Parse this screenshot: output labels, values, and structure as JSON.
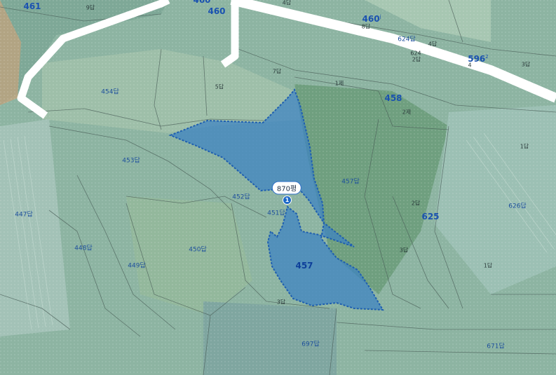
{
  "map": {
    "selection": {
      "area_label": "870평",
      "marker_number": "1",
      "parcel_number": "457"
    },
    "parcel_numbers": [
      {
        "id": "p461",
        "text": "461"
      },
      {
        "id": "p460",
        "text": "460"
      },
      {
        "id": "p460b",
        "text": "460"
      },
      {
        "id": "p458",
        "text": "458"
      },
      {
        "id": "p596",
        "text": "596"
      },
      {
        "id": "p625",
        "text": "625"
      }
    ],
    "parcel_numbers_suffix": {
      "p460b": "j",
      "p596": "2"
    },
    "lot_labels": [
      {
        "id": "l9dap",
        "text": "9답"
      },
      {
        "id": "l4dap_top",
        "text": "4답"
      },
      {
        "id": "l8dap",
        "text": "8답"
      },
      {
        "id": "l624dap",
        "text": "624답"
      },
      {
        "id": "l4dap_r",
        "text": "4답"
      },
      {
        "id": "l624",
        "text": "624"
      },
      {
        "id": "l2dap_top",
        "text": "2답"
      },
      {
        "id": "l4",
        "text": "4"
      },
      {
        "id": "l3dap_r",
        "text": "3답"
      },
      {
        "id": "l7dap",
        "text": "7답"
      },
      {
        "id": "l1je",
        "text": "1제"
      },
      {
        "id": "l454dap",
        "text": "454답"
      },
      {
        "id": "l5dap",
        "text": "5답"
      },
      {
        "id": "l2je",
        "text": "2제"
      },
      {
        "id": "l1dap_r",
        "text": "1답"
      },
      {
        "id": "l453dap",
        "text": "453답"
      },
      {
        "id": "l457dap",
        "text": "457답"
      },
      {
        "id": "l452dap",
        "text": "452답"
      },
      {
        "id": "l447dap",
        "text": "447답"
      },
      {
        "id": "l451dap",
        "text": "451답"
      },
      {
        "id": "l2dap_m",
        "text": "2답"
      },
      {
        "id": "l626dap",
        "text": "626답"
      },
      {
        "id": "l448dap",
        "text": "448답"
      },
      {
        "id": "l450dap",
        "text": "450답"
      },
      {
        "id": "l449dap",
        "text": "449답"
      },
      {
        "id": "l3dap_m",
        "text": "3답"
      },
      {
        "id": "l1dap_b",
        "text": "1답"
      },
      {
        "id": "l3dap_b",
        "text": "3답"
      },
      {
        "id": "l697dap",
        "text": "697답"
      },
      {
        "id": "l671dap",
        "text": "671답"
      }
    ],
    "colors": {
      "selection_fill": "#3b82c4",
      "selection_stroke": "#1f5fb0",
      "road": "#ffffff",
      "parcel_line": "#4a5e58",
      "label_blue": "#1d4f9c"
    }
  }
}
